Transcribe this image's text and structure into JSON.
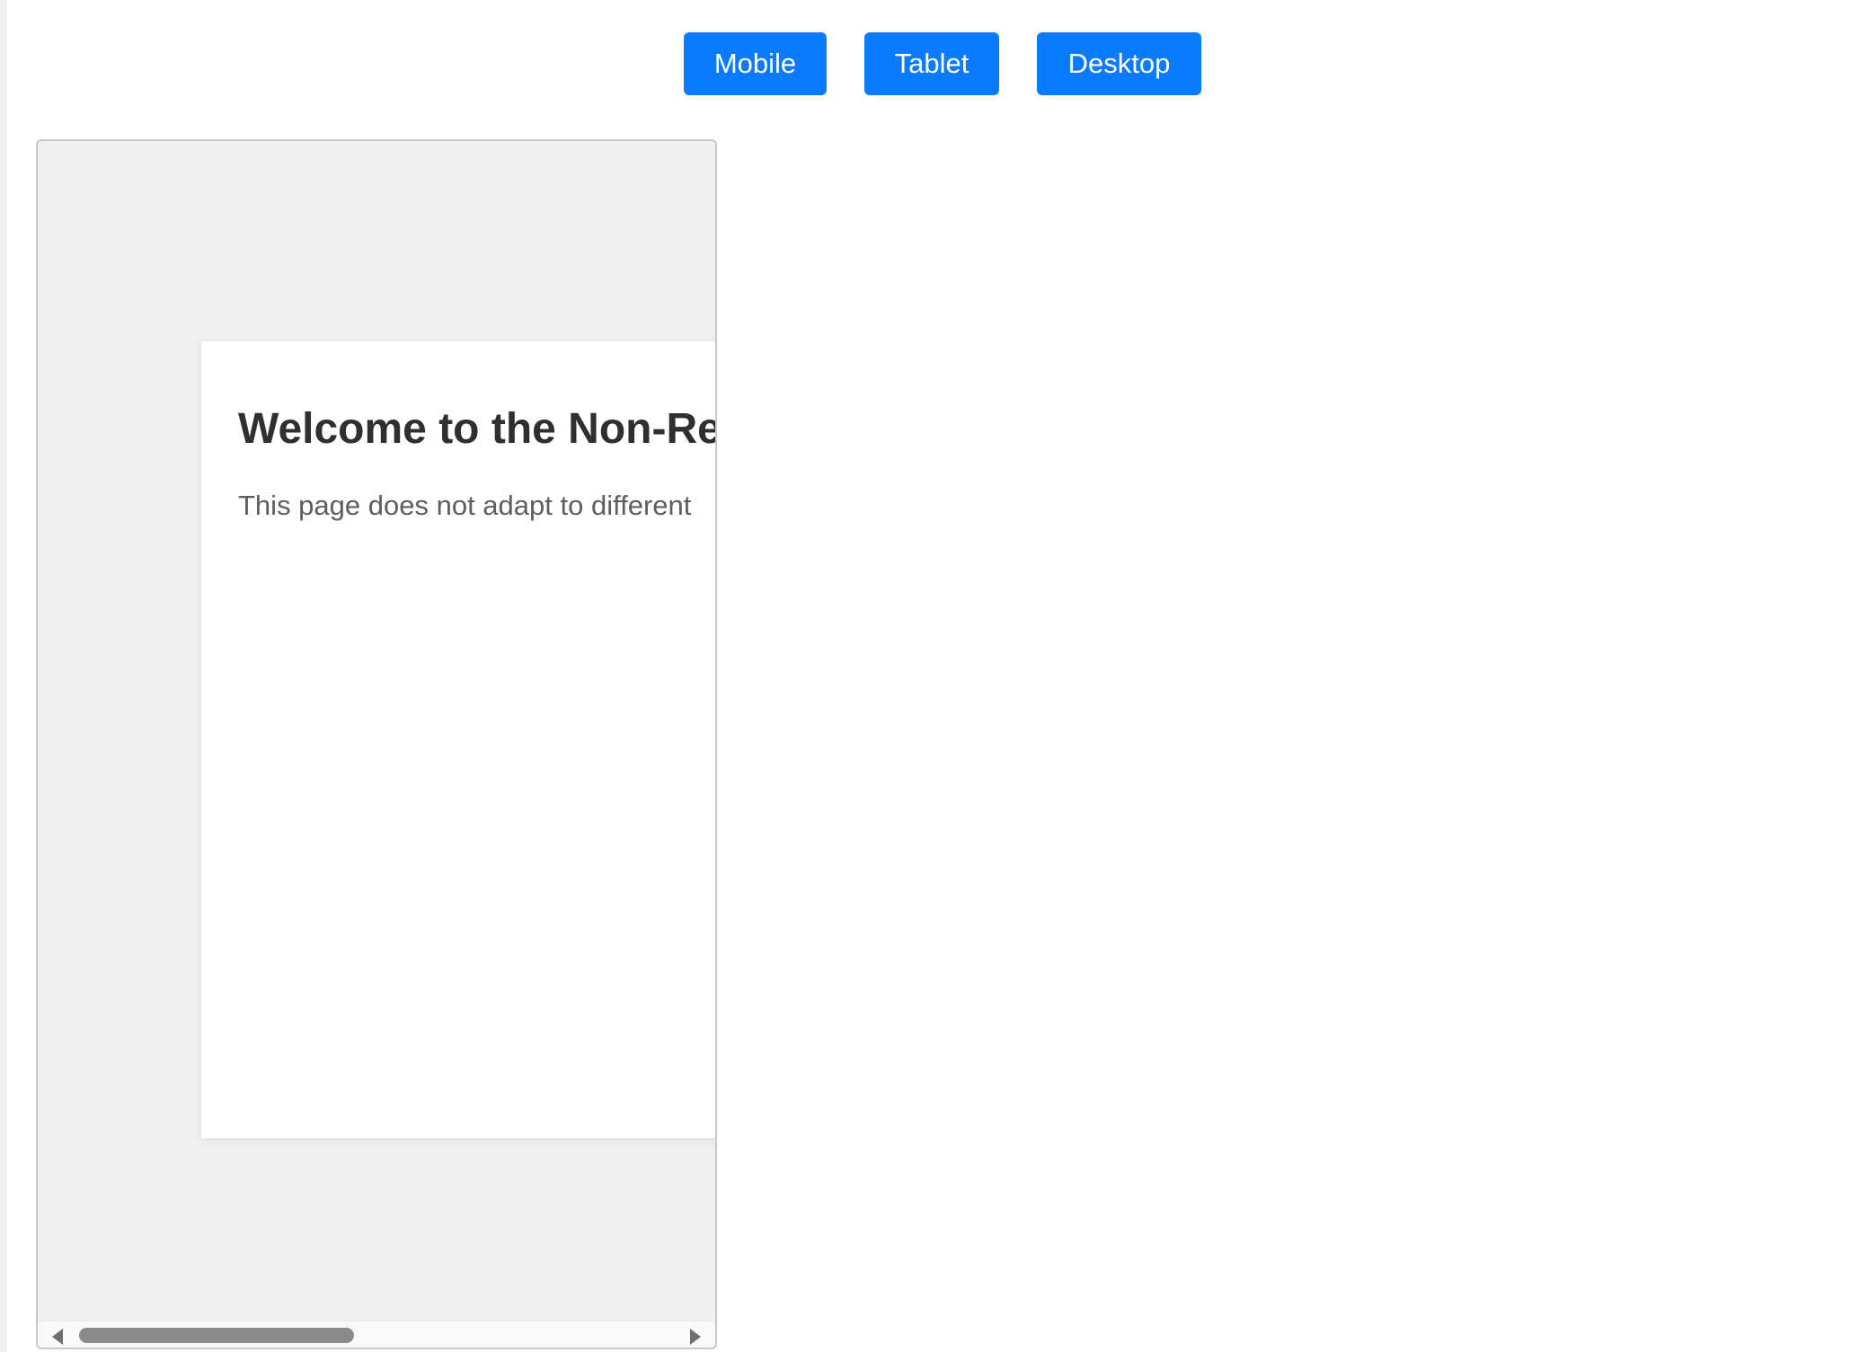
{
  "toolbar": {
    "mobile_label": "Mobile",
    "tablet_label": "Tablet",
    "desktop_label": "Desktop"
  },
  "preview": {
    "title": "Welcome to the Non-Re",
    "description": "This page does not adapt to different"
  },
  "colors": {
    "button": "#0a7bff",
    "frame_bg": "#f0f0f0",
    "card_bg": "#ffffff"
  },
  "icons": {
    "scroll_left": "scroll-left-arrow-icon",
    "scroll_right": "scroll-right-arrow-icon"
  }
}
